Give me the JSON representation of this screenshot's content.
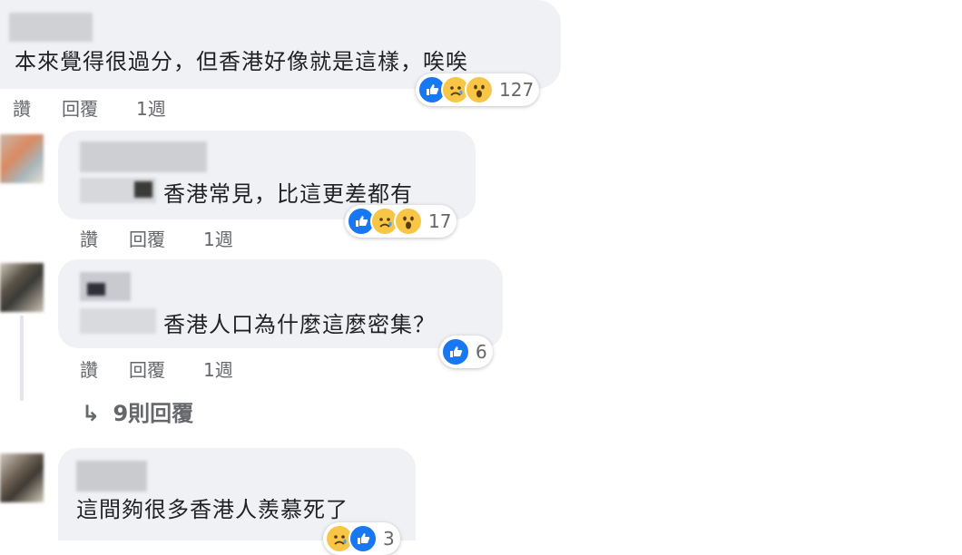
{
  "comments": [
    {
      "text": "本來覺得很過分，但香港好像就是這樣，唉唉",
      "actions": {
        "like": "讚",
        "reply": "回覆",
        "time": "1週"
      },
      "reaction_count": "127",
      "reactions": [
        "like",
        "sad",
        "wow"
      ]
    },
    {
      "text": "香港常見，比這更差都有",
      "actions": {
        "like": "讚",
        "reply": "回覆",
        "time": "1週"
      },
      "reaction_count": "17",
      "reactions": [
        "like",
        "sad",
        "wow"
      ]
    },
    {
      "text": "香港人口為什麼這麼密集？",
      "actions": {
        "like": "讚",
        "reply": "回覆",
        "time": "1週"
      },
      "reaction_count": "6",
      "reactions": [
        "like"
      ]
    },
    {
      "text": "這間夠很多香港人羨慕死了",
      "reaction_count": "3",
      "reactions": [
        "sad",
        "like"
      ]
    }
  ],
  "view_replies": {
    "arrow": "↳",
    "label": "9則回覆"
  },
  "colors": {
    "bubble": "#eff1f5",
    "like": "#1877f2",
    "emoji": "#f7c646",
    "muted": "#65676b"
  }
}
